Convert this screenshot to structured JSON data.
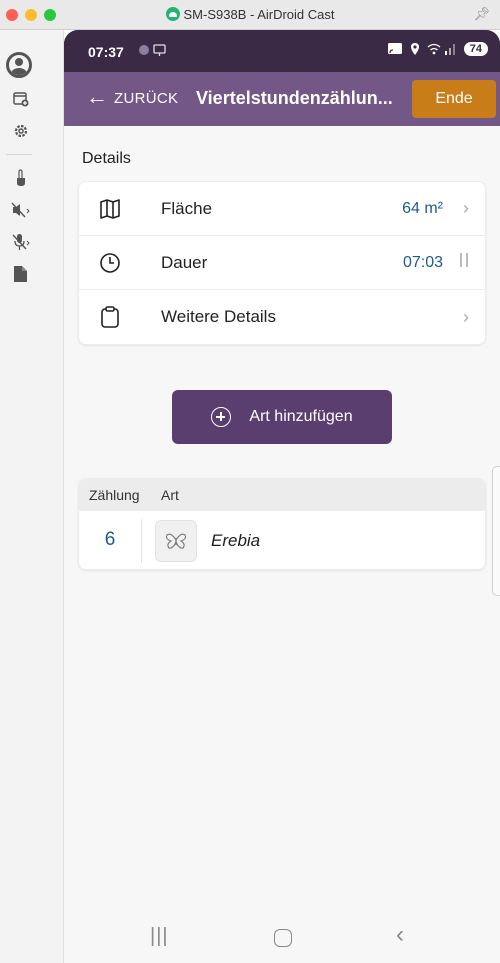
{
  "window": {
    "title": "SM-S938B - AirDroid Cast"
  },
  "status_bar": {
    "time": "07:37",
    "battery": "74"
  },
  "app_bar": {
    "back_label": "ZURÜCK",
    "title": "Viertelstundenzählun...",
    "end_label": "Ende"
  },
  "details": {
    "section_label": "Details",
    "rows": [
      {
        "label": "Fläche",
        "value": "64 m²",
        "icon": "map-icon"
      },
      {
        "label": "Dauer",
        "value": "07:03",
        "icon": "clock-icon"
      },
      {
        "label": "Weitere Details",
        "value": "",
        "icon": "clipboard-icon"
      }
    ]
  },
  "add_species": {
    "label": "Art hinzufügen"
  },
  "counts": {
    "header_count": "Zählung",
    "header_species": "Art",
    "rows": [
      {
        "count": "6",
        "species": "Erebia",
        "icon": "butterfly-icon"
      }
    ]
  },
  "colors": {
    "app_bar": "#735787",
    "status_bar": "#3b2a45",
    "accent_button": "#c97d19",
    "primary_button": "#5b3e70",
    "value_text": "#1e5b8a"
  }
}
